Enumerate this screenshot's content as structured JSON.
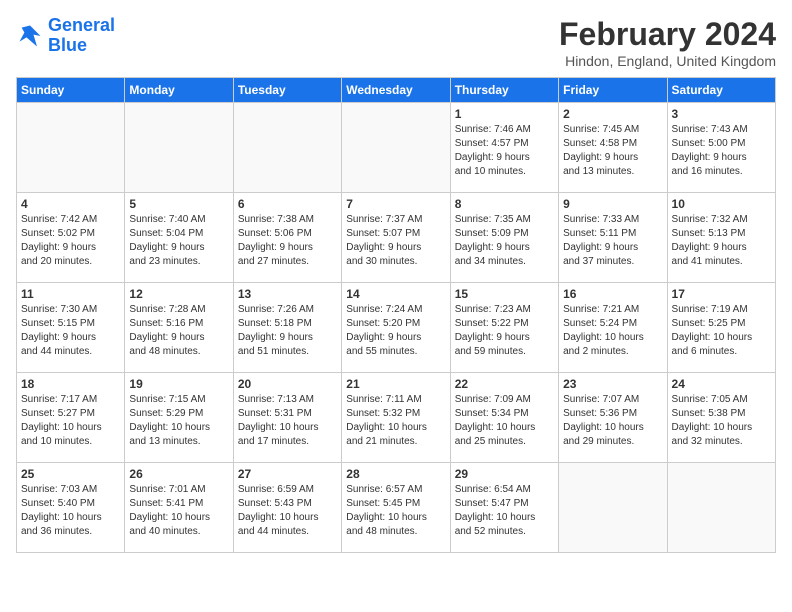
{
  "header": {
    "logo_general": "General",
    "logo_blue": "Blue",
    "month": "February 2024",
    "location": "Hindon, England, United Kingdom"
  },
  "days_of_week": [
    "Sunday",
    "Monday",
    "Tuesday",
    "Wednesday",
    "Thursday",
    "Friday",
    "Saturday"
  ],
  "weeks": [
    [
      {
        "day": "",
        "content": ""
      },
      {
        "day": "",
        "content": ""
      },
      {
        "day": "",
        "content": ""
      },
      {
        "day": "",
        "content": ""
      },
      {
        "day": "1",
        "content": "Sunrise: 7:46 AM\nSunset: 4:57 PM\nDaylight: 9 hours\nand 10 minutes."
      },
      {
        "day": "2",
        "content": "Sunrise: 7:45 AM\nSunset: 4:58 PM\nDaylight: 9 hours\nand 13 minutes."
      },
      {
        "day": "3",
        "content": "Sunrise: 7:43 AM\nSunset: 5:00 PM\nDaylight: 9 hours\nand 16 minutes."
      }
    ],
    [
      {
        "day": "4",
        "content": "Sunrise: 7:42 AM\nSunset: 5:02 PM\nDaylight: 9 hours\nand 20 minutes."
      },
      {
        "day": "5",
        "content": "Sunrise: 7:40 AM\nSunset: 5:04 PM\nDaylight: 9 hours\nand 23 minutes."
      },
      {
        "day": "6",
        "content": "Sunrise: 7:38 AM\nSunset: 5:06 PM\nDaylight: 9 hours\nand 27 minutes."
      },
      {
        "day": "7",
        "content": "Sunrise: 7:37 AM\nSunset: 5:07 PM\nDaylight: 9 hours\nand 30 minutes."
      },
      {
        "day": "8",
        "content": "Sunrise: 7:35 AM\nSunset: 5:09 PM\nDaylight: 9 hours\nand 34 minutes."
      },
      {
        "day": "9",
        "content": "Sunrise: 7:33 AM\nSunset: 5:11 PM\nDaylight: 9 hours\nand 37 minutes."
      },
      {
        "day": "10",
        "content": "Sunrise: 7:32 AM\nSunset: 5:13 PM\nDaylight: 9 hours\nand 41 minutes."
      }
    ],
    [
      {
        "day": "11",
        "content": "Sunrise: 7:30 AM\nSunset: 5:15 PM\nDaylight: 9 hours\nand 44 minutes."
      },
      {
        "day": "12",
        "content": "Sunrise: 7:28 AM\nSunset: 5:16 PM\nDaylight: 9 hours\nand 48 minutes."
      },
      {
        "day": "13",
        "content": "Sunrise: 7:26 AM\nSunset: 5:18 PM\nDaylight: 9 hours\nand 51 minutes."
      },
      {
        "day": "14",
        "content": "Sunrise: 7:24 AM\nSunset: 5:20 PM\nDaylight: 9 hours\nand 55 minutes."
      },
      {
        "day": "15",
        "content": "Sunrise: 7:23 AM\nSunset: 5:22 PM\nDaylight: 9 hours\nand 59 minutes."
      },
      {
        "day": "16",
        "content": "Sunrise: 7:21 AM\nSunset: 5:24 PM\nDaylight: 10 hours\nand 2 minutes."
      },
      {
        "day": "17",
        "content": "Sunrise: 7:19 AM\nSunset: 5:25 PM\nDaylight: 10 hours\nand 6 minutes."
      }
    ],
    [
      {
        "day": "18",
        "content": "Sunrise: 7:17 AM\nSunset: 5:27 PM\nDaylight: 10 hours\nand 10 minutes."
      },
      {
        "day": "19",
        "content": "Sunrise: 7:15 AM\nSunset: 5:29 PM\nDaylight: 10 hours\nand 13 minutes."
      },
      {
        "day": "20",
        "content": "Sunrise: 7:13 AM\nSunset: 5:31 PM\nDaylight: 10 hours\nand 17 minutes."
      },
      {
        "day": "21",
        "content": "Sunrise: 7:11 AM\nSunset: 5:32 PM\nDaylight: 10 hours\nand 21 minutes."
      },
      {
        "day": "22",
        "content": "Sunrise: 7:09 AM\nSunset: 5:34 PM\nDaylight: 10 hours\nand 25 minutes."
      },
      {
        "day": "23",
        "content": "Sunrise: 7:07 AM\nSunset: 5:36 PM\nDaylight: 10 hours\nand 29 minutes."
      },
      {
        "day": "24",
        "content": "Sunrise: 7:05 AM\nSunset: 5:38 PM\nDaylight: 10 hours\nand 32 minutes."
      }
    ],
    [
      {
        "day": "25",
        "content": "Sunrise: 7:03 AM\nSunset: 5:40 PM\nDaylight: 10 hours\nand 36 minutes."
      },
      {
        "day": "26",
        "content": "Sunrise: 7:01 AM\nSunset: 5:41 PM\nDaylight: 10 hours\nand 40 minutes."
      },
      {
        "day": "27",
        "content": "Sunrise: 6:59 AM\nSunset: 5:43 PM\nDaylight: 10 hours\nand 44 minutes."
      },
      {
        "day": "28",
        "content": "Sunrise: 6:57 AM\nSunset: 5:45 PM\nDaylight: 10 hours\nand 48 minutes."
      },
      {
        "day": "29",
        "content": "Sunrise: 6:54 AM\nSunset: 5:47 PM\nDaylight: 10 hours\nand 52 minutes."
      },
      {
        "day": "",
        "content": ""
      },
      {
        "day": "",
        "content": ""
      }
    ]
  ]
}
